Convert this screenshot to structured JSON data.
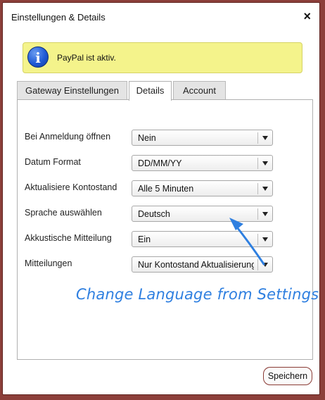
{
  "dialog": {
    "title": "Einstellungen & Details",
    "close_label": "×"
  },
  "notice": {
    "icon": "info-icon",
    "icon_glyph": "i",
    "text": "PayPal ist aktiv."
  },
  "tabs": [
    {
      "label": "Gateway Einstellungen",
      "active": false
    },
    {
      "label": "Details",
      "active": true
    },
    {
      "label": "Account",
      "active": false
    }
  ],
  "settings": [
    {
      "label": "Bei Anmeldung öffnen",
      "value": "Nein"
    },
    {
      "label": "Datum Format",
      "value": "DD/MM/YY"
    },
    {
      "label": "Aktualisiere Kontostand",
      "value": "Alle 5 Minuten"
    },
    {
      "label": "Sprache auswählen",
      "value": "Deutsch"
    },
    {
      "label": "Akkustische Mitteilung",
      "value": "Ein"
    },
    {
      "label": "Mitteilungen",
      "value": "Nur Kontostand Aktualisierung"
    }
  ],
  "annotation": {
    "text": "Change Language from Settings",
    "color": "#2e7fe0"
  },
  "footer": {
    "save_label": "Speichern"
  }
}
